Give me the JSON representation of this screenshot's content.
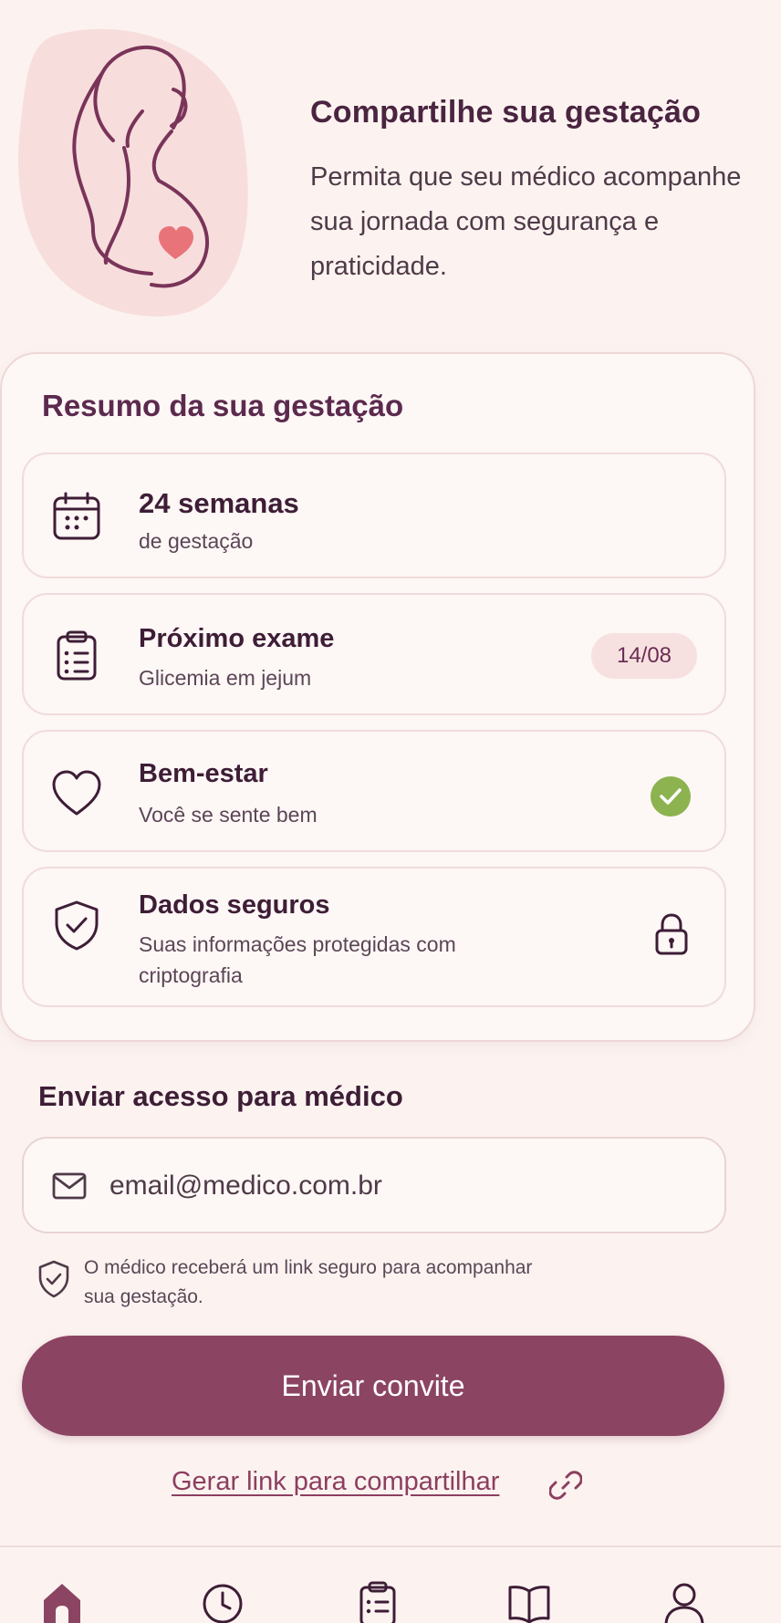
{
  "hero": {
    "title": "Compartilhe sua gestação",
    "description": "Permita que seu médico acompanhe sua jornada com segurança e praticidade."
  },
  "summary": {
    "title": "Resumo da sua gestação",
    "items": [
      {
        "title": "24 semanas",
        "subtitle": "de gestação",
        "icon": "calendar-icon"
      },
      {
        "title": "Próximo exame",
        "subtitle": "Glicemia em jejum",
        "badge": "14/08",
        "icon": "clipboard-icon"
      },
      {
        "title": "Bem-estar",
        "subtitle": "Você se sente bem",
        "icon": "heart-icon",
        "status_icon": "check-icon"
      },
      {
        "title": "Dados seguros",
        "subtitle": "Suas informações protegidas com criptografia",
        "icon": "shield-check-icon",
        "status_icon": "lock-icon"
      }
    ]
  },
  "send_access": {
    "title": "Enviar acesso para médico",
    "email_placeholder": "email@medico.com.br",
    "hint": "O médico receberá um link seguro para acompanhar sua gestação.",
    "button_label": "Enviar convite",
    "share_link_label": "Gerar link para compartilhar"
  },
  "colors": {
    "background": "#fcf3f0",
    "primary": "#8c4463",
    "heading": "#4a2440",
    "success": "#8cb34f",
    "heart_accent": "#e8747a"
  },
  "nav": {
    "items": [
      {
        "icon": "home-icon",
        "active": true
      },
      {
        "icon": "clock-icon",
        "active": false
      },
      {
        "icon": "clipboard-icon",
        "active": false
      },
      {
        "icon": "book-icon",
        "active": false
      },
      {
        "icon": "profile-icon",
        "active": false
      }
    ]
  }
}
